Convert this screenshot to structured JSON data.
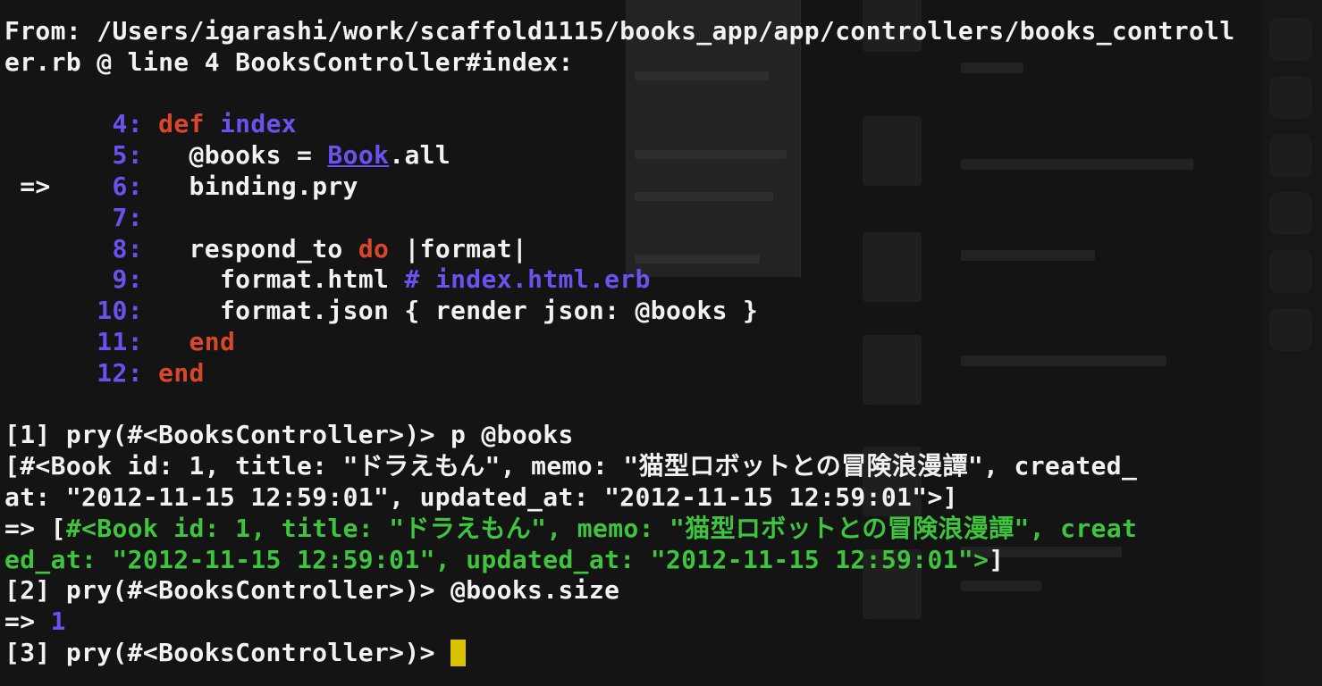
{
  "terminal": {
    "header": [
      "From: /Users/igarashi/work/scaffold1115/books_app/app/controllers/books_controll",
      "er.rb @ line 4 BooksController#index:"
    ],
    "code": [
      {
        "marker": "",
        "num": "4",
        "kw": "def",
        "name": "index"
      },
      {
        "marker": "",
        "num": "5",
        "pre": "  @books = ",
        "cls": "Book",
        "post": ".all"
      },
      {
        "marker": "=>",
        "num": "6",
        "text": "  binding.pry"
      },
      {
        "marker": "",
        "num": "7",
        "text": ""
      },
      {
        "marker": "",
        "num": "8",
        "pre": "  respond_to ",
        "kw": "do",
        "post": " |format|"
      },
      {
        "marker": "",
        "num": "9",
        "pre": "    format.html ",
        "comment": "# index.html.erb"
      },
      {
        "marker": "",
        "num": "10",
        "text": "    format.json { render json: @books }"
      },
      {
        "marker": "",
        "num": "11",
        "indent": "  ",
        "kw": "end"
      },
      {
        "marker": "",
        "num": "12",
        "kw": "end"
      }
    ],
    "session": [
      {
        "prompt": "[1] pry(#<BooksController>)> ",
        "input": "p @books"
      },
      {
        "output": [
          "[#<Book id: 1, title: \"ドラえもん\", memo: \"猫型ロボットとの冒険浪漫譚\", created_",
          "at: \"2012-11-15 12:59:01\", updated_at: \"2012-11-15 12:59:01\">]"
        ]
      },
      {
        "result_arrow": "=> ",
        "result_open": "[",
        "result": [
          "#<Book id: 1, title: \"ドラえもん\", memo: \"猫型ロボットとの冒険浪漫譚\", creat",
          "ed_at: \"2012-11-15 12:59:01\", updated_at: \"2012-11-15 12:59:01\">"
        ],
        "result_close": "]"
      },
      {
        "prompt": "[2] pry(#<BooksController>)> ",
        "input": "@books.size"
      },
      {
        "result_arrow": "=> ",
        "value": "1"
      },
      {
        "prompt": "[3] pry(#<BooksController>)> ",
        "input": ""
      }
    ]
  },
  "colors": {
    "background": "#141414",
    "text": "#f2f2f2",
    "line_number": "#6a52f0",
    "keyword": "#d9472b",
    "string_result": "#3ec43e",
    "cursor": "#d8c200"
  }
}
